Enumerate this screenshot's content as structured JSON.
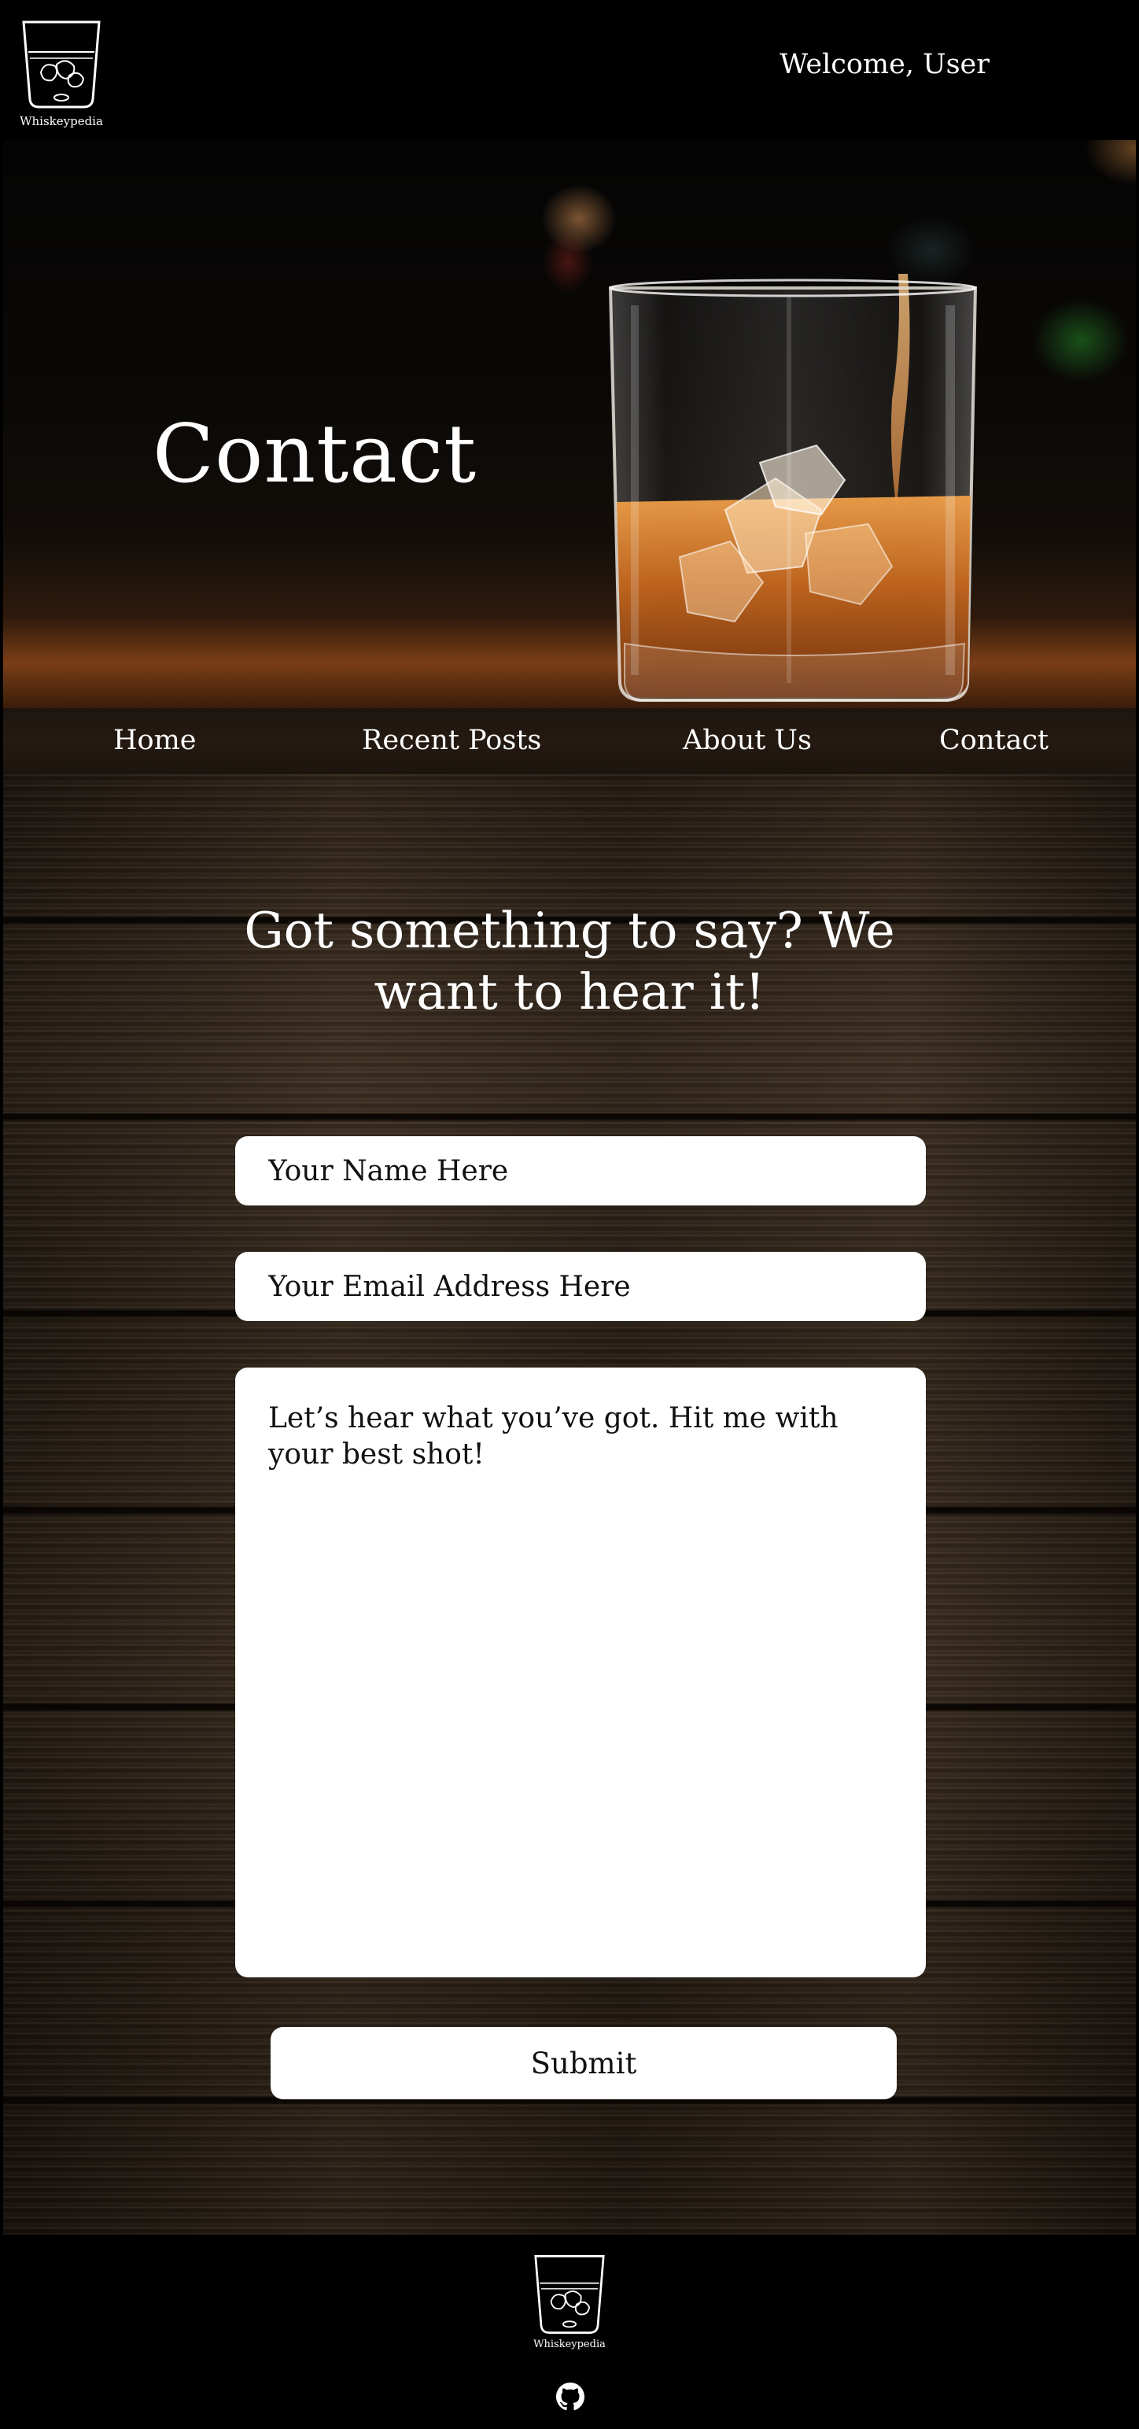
{
  "header": {
    "logo_text": "Whiskeypedia",
    "welcome": "Welcome, User"
  },
  "hero": {
    "title": "Contact"
  },
  "nav": {
    "items": [
      {
        "label": "Home"
      },
      {
        "label": "Recent Posts"
      },
      {
        "label": "About Us"
      },
      {
        "label": "Contact"
      }
    ]
  },
  "contact": {
    "headline": "Got something to say? We want to hear it!",
    "name_placeholder": "Your Name Here",
    "email_placeholder": "Your Email Address Here",
    "message_placeholder": "Let’s hear what you’ve got. Hit me with your best shot!",
    "submit_label": "Submit"
  },
  "footer": {
    "logo_text": "Whiskeypedia",
    "github_icon": "github-icon"
  },
  "colors": {
    "page_background": "#000000",
    "text": "#ffffff",
    "field_background": "#ffffff",
    "field_text": "#111111",
    "whiskey_amber": "#c2651d"
  }
}
